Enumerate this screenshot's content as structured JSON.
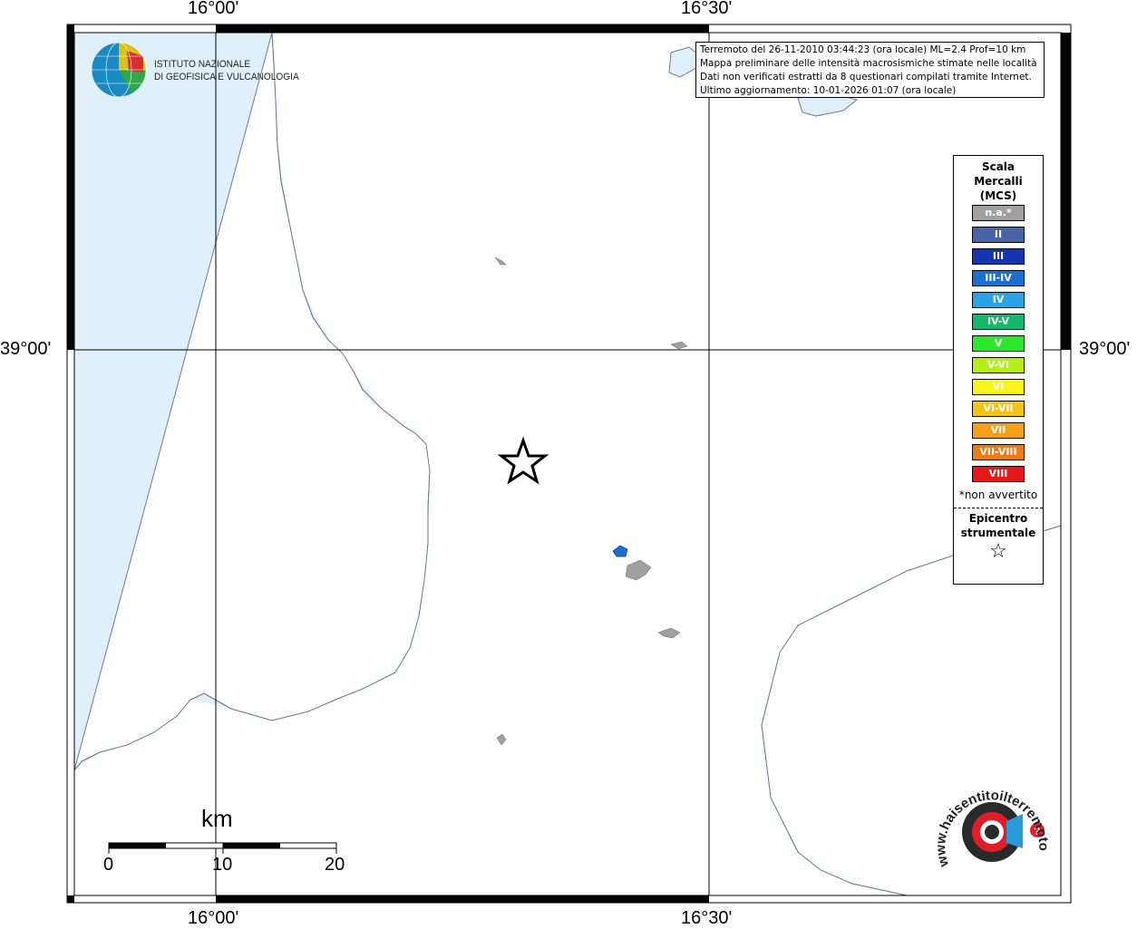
{
  "map": {
    "lon_labels": [
      "16°00'",
      "16°30'"
    ],
    "lat_labels": [
      "39°00'"
    ],
    "colors": {
      "sea": "#e0f0fb",
      "land": "#ffffff",
      "coast": "#6b7b8a",
      "grid": "#000000"
    }
  },
  "logo": {
    "line1": "ISTITUTO NAZIONALE",
    "line2": "DI GEOFISICA E VULCANOLOGIA",
    "icon": "ingv-globe-logo"
  },
  "info": {
    "line1": "Terremoto del 26-11-2010 03:44:23 (ora locale) ML=2.4 Prof=10 km",
    "line2": "Mappa preliminare delle intensità macrosismiche stimate nelle località",
    "line3": "Dati non verificati estratti da 8 questionari compilati tramite Internet.",
    "line4": "Ultimo aggiornamento: 10-01-2026 01:07 (ora locale)"
  },
  "legend": {
    "title1": "Scala",
    "title2": "Mercalli",
    "title3": "(MCS)",
    "items": [
      {
        "label": "n.a.*",
        "color": "#a0a0a0"
      },
      {
        "label": "II",
        "color": "#4a63a8"
      },
      {
        "label": "III",
        "color": "#1535b0"
      },
      {
        "label": "III-IV",
        "color": "#1a6fd0"
      },
      {
        "label": "IV",
        "color": "#2aa4e6"
      },
      {
        "label": "IV-V",
        "color": "#14b86a"
      },
      {
        "label": "V",
        "color": "#2ee82e"
      },
      {
        "label": "V-VI",
        "color": "#b6ee1a"
      },
      {
        "label": "VI",
        "color": "#f7f51a"
      },
      {
        "label": "VI-VII",
        "color": "#f5c21a"
      },
      {
        "label": "VII",
        "color": "#f5a01a"
      },
      {
        "label": "VII-VIII",
        "color": "#ef7a12"
      },
      {
        "label": "VIII",
        "color": "#e61818"
      }
    ],
    "note": "*non avvertito",
    "epicenter1": "Epicentro",
    "epicenter2": "strumentale",
    "star_icon": "☆"
  },
  "scale_bar": {
    "title": "km",
    "labels": [
      "0",
      "10",
      "20"
    ]
  },
  "localities": [
    {
      "intensity": "n.a.*"
    },
    {
      "intensity": "n.a.*"
    },
    {
      "intensity": "III-IV"
    },
    {
      "intensity": "n.a.*"
    },
    {
      "intensity": "n.a.*"
    },
    {
      "intensity": "n.a.*"
    }
  ],
  "epicenter": {
    "icon": "epicenter-star-icon"
  },
  "watermark": {
    "text": "www.haisentitoilterremoto.it",
    "icon": "haisentito-logo"
  }
}
